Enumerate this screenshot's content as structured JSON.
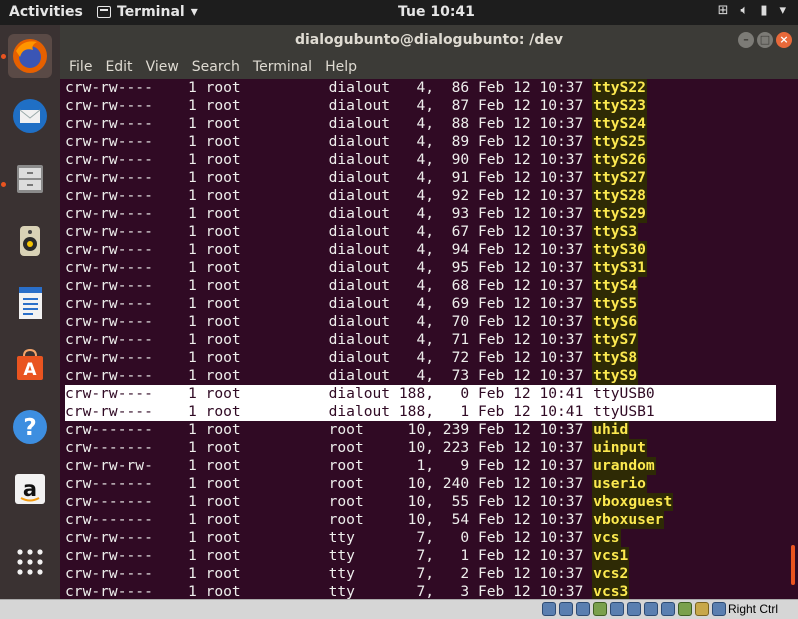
{
  "topbar": {
    "activities": "Activities",
    "app_name": "Terminal",
    "clock": "Tue 10:41",
    "tray_icons": [
      "network-icon",
      "volume-icon",
      "battery-icon",
      "power-menu-icon"
    ]
  },
  "dock": {
    "items": [
      "firefox-icon",
      "thunderbird-icon",
      "files-icon",
      "rhythmbox-icon",
      "libreoffice-writer-icon",
      "software-center-icon",
      "help-icon",
      "amazon-icon",
      "show-apps-icon"
    ]
  },
  "window": {
    "title": "dialogubunto@dialogubunto: /dev",
    "menu": [
      "File",
      "Edit",
      "View",
      "Search",
      "Terminal",
      "Help"
    ]
  },
  "terminal": {
    "lines": [
      {
        "perm": "crw-rw----",
        "links": "1",
        "owner": "root",
        "group": "dialout",
        "major": "4,",
        "minor": "86",
        "date": "Feb 12 10:37",
        "name": "ttyS22"
      },
      {
        "perm": "crw-rw----",
        "links": "1",
        "owner": "root",
        "group": "dialout",
        "major": "4,",
        "minor": "87",
        "date": "Feb 12 10:37",
        "name": "ttyS23"
      },
      {
        "perm": "crw-rw----",
        "links": "1",
        "owner": "root",
        "group": "dialout",
        "major": "4,",
        "minor": "88",
        "date": "Feb 12 10:37",
        "name": "ttyS24"
      },
      {
        "perm": "crw-rw----",
        "links": "1",
        "owner": "root",
        "group": "dialout",
        "major": "4,",
        "minor": "89",
        "date": "Feb 12 10:37",
        "name": "ttyS25"
      },
      {
        "perm": "crw-rw----",
        "links": "1",
        "owner": "root",
        "group": "dialout",
        "major": "4,",
        "minor": "90",
        "date": "Feb 12 10:37",
        "name": "ttyS26"
      },
      {
        "perm": "crw-rw----",
        "links": "1",
        "owner": "root",
        "group": "dialout",
        "major": "4,",
        "minor": "91",
        "date": "Feb 12 10:37",
        "name": "ttyS27"
      },
      {
        "perm": "crw-rw----",
        "links": "1",
        "owner": "root",
        "group": "dialout",
        "major": "4,",
        "minor": "92",
        "date": "Feb 12 10:37",
        "name": "ttyS28"
      },
      {
        "perm": "crw-rw----",
        "links": "1",
        "owner": "root",
        "group": "dialout",
        "major": "4,",
        "minor": "93",
        "date": "Feb 12 10:37",
        "name": "ttyS29"
      },
      {
        "perm": "crw-rw----",
        "links": "1",
        "owner": "root",
        "group": "dialout",
        "major": "4,",
        "minor": "67",
        "date": "Feb 12 10:37",
        "name": "ttyS3"
      },
      {
        "perm": "crw-rw----",
        "links": "1",
        "owner": "root",
        "group": "dialout",
        "major": "4,",
        "minor": "94",
        "date": "Feb 12 10:37",
        "name": "ttyS30"
      },
      {
        "perm": "crw-rw----",
        "links": "1",
        "owner": "root",
        "group": "dialout",
        "major": "4,",
        "minor": "95",
        "date": "Feb 12 10:37",
        "name": "ttyS31"
      },
      {
        "perm": "crw-rw----",
        "links": "1",
        "owner": "root",
        "group": "dialout",
        "major": "4,",
        "minor": "68",
        "date": "Feb 12 10:37",
        "name": "ttyS4"
      },
      {
        "perm": "crw-rw----",
        "links": "1",
        "owner": "root",
        "group": "dialout",
        "major": "4,",
        "minor": "69",
        "date": "Feb 12 10:37",
        "name": "ttyS5"
      },
      {
        "perm": "crw-rw----",
        "links": "1",
        "owner": "root",
        "group": "dialout",
        "major": "4,",
        "minor": "70",
        "date": "Feb 12 10:37",
        "name": "ttyS6"
      },
      {
        "perm": "crw-rw----",
        "links": "1",
        "owner": "root",
        "group": "dialout",
        "major": "4,",
        "minor": "71",
        "date": "Feb 12 10:37",
        "name": "ttyS7"
      },
      {
        "perm": "crw-rw----",
        "links": "1",
        "owner": "root",
        "group": "dialout",
        "major": "4,",
        "minor": "72",
        "date": "Feb 12 10:37",
        "name": "ttyS8"
      },
      {
        "perm": "crw-rw----",
        "links": "1",
        "owner": "root",
        "group": "dialout",
        "major": "4,",
        "minor": "73",
        "date": "Feb 12 10:37",
        "name": "ttyS9"
      },
      {
        "perm": "crw-rw----",
        "links": "1",
        "owner": "root",
        "group": "dialout",
        "major": "188,",
        "minor": "0",
        "date": "Feb 12 10:41",
        "name": "ttyUSB0",
        "highlight": true
      },
      {
        "perm": "crw-rw----",
        "links": "1",
        "owner": "root",
        "group": "dialout",
        "major": "188,",
        "minor": "1",
        "date": "Feb 12 10:41",
        "name": "ttyUSB1",
        "highlight": true
      },
      {
        "perm": "crw-------",
        "links": "1",
        "owner": "root",
        "group": "root",
        "major": "10,",
        "minor": "239",
        "date": "Feb 12 10:37",
        "name": "uhid"
      },
      {
        "perm": "crw-------",
        "links": "1",
        "owner": "root",
        "group": "root",
        "major": "10,",
        "minor": "223",
        "date": "Feb 12 10:37",
        "name": "uinput"
      },
      {
        "perm": "crw-rw-rw-",
        "links": "1",
        "owner": "root",
        "group": "root",
        "major": "1,",
        "minor": "9",
        "date": "Feb 12 10:37",
        "name": "urandom"
      },
      {
        "perm": "crw-------",
        "links": "1",
        "owner": "root",
        "group": "root",
        "major": "10,",
        "minor": "240",
        "date": "Feb 12 10:37",
        "name": "userio"
      },
      {
        "perm": "crw-------",
        "links": "1",
        "owner": "root",
        "group": "root",
        "major": "10,",
        "minor": "55",
        "date": "Feb 12 10:37",
        "name": "vboxguest"
      },
      {
        "perm": "crw-------",
        "links": "1",
        "owner": "root",
        "group": "root",
        "major": "10,",
        "minor": "54",
        "date": "Feb 12 10:37",
        "name": "vboxuser"
      },
      {
        "perm": "crw-rw----",
        "links": "1",
        "owner": "root",
        "group": "tty",
        "major": "7,",
        "minor": "0",
        "date": "Feb 12 10:37",
        "name": "vcs"
      },
      {
        "perm": "crw-rw----",
        "links": "1",
        "owner": "root",
        "group": "tty",
        "major": "7,",
        "minor": "1",
        "date": "Feb 12 10:37",
        "name": "vcs1"
      },
      {
        "perm": "crw-rw----",
        "links": "1",
        "owner": "root",
        "group": "tty",
        "major": "7,",
        "minor": "2",
        "date": "Feb 12 10:37",
        "name": "vcs2"
      },
      {
        "perm": "crw-rw----",
        "links": "1",
        "owner": "root",
        "group": "tty",
        "major": "7,",
        "minor": "3",
        "date": "Feb 12 10:37",
        "name": "vcs3"
      }
    ]
  },
  "statusbar": {
    "host_key": "Right Ctrl"
  },
  "colors": {
    "terminal_bg": "#300a24",
    "highlight_name": "#fce94f",
    "accent": "#e95420"
  }
}
